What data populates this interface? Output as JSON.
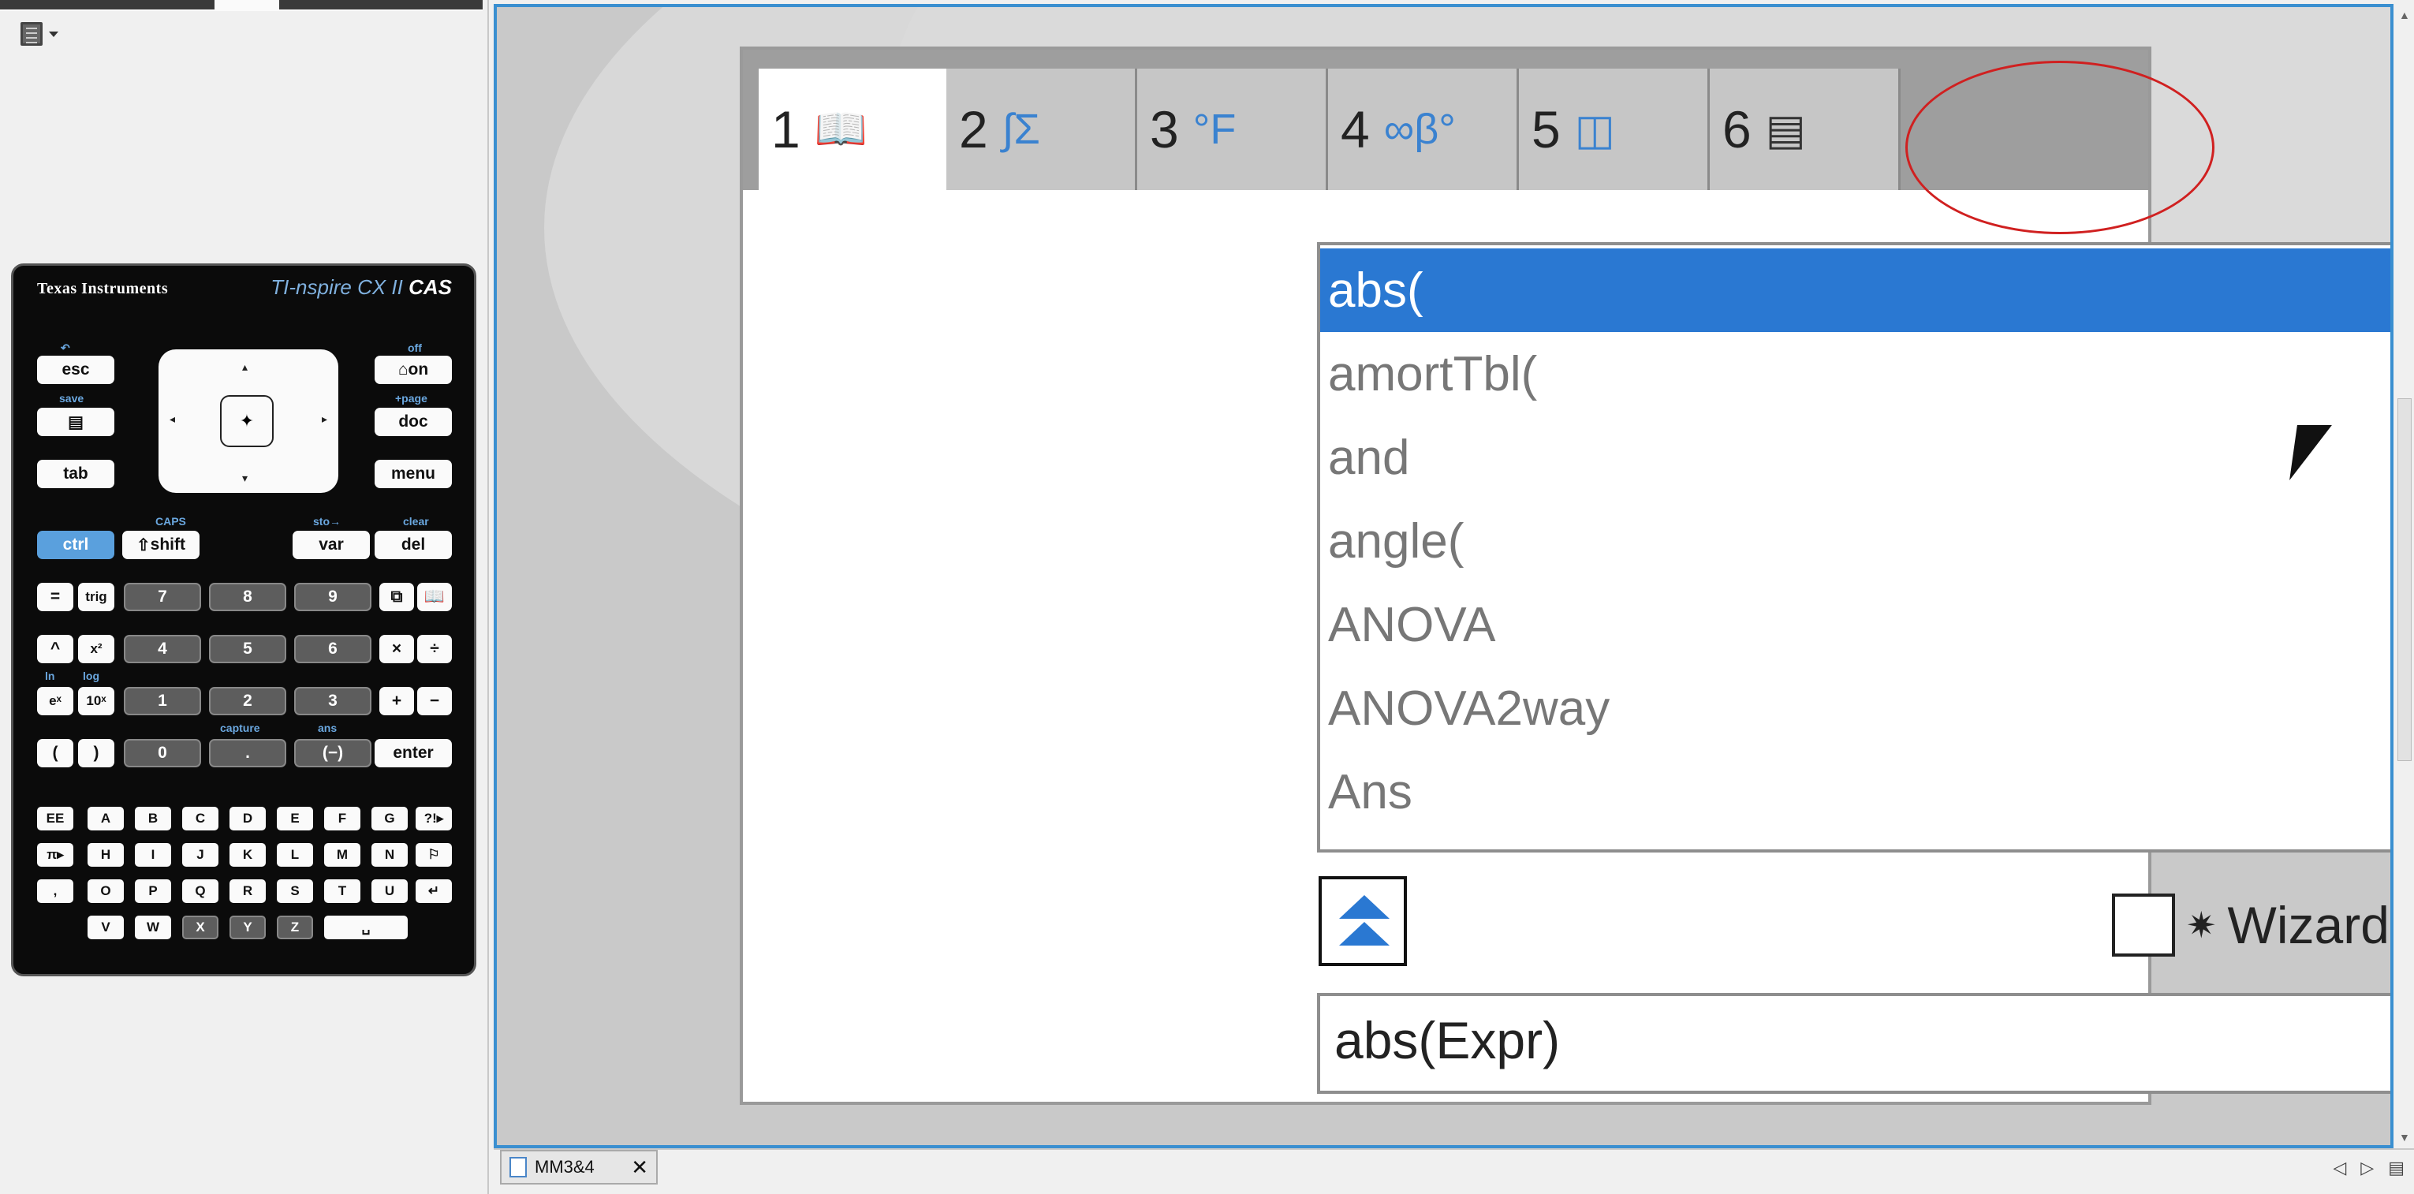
{
  "left_panel": {
    "menu_icon": "page-sorter-icon",
    "calculator": {
      "brand": "Texas Instruments",
      "model": "TI-nspire CX II",
      "model_suffix": "CAS",
      "keys_top": [
        "esc",
        "on",
        "doc",
        "tab",
        "menu"
      ],
      "labels_top": [
        "save",
        "off",
        "+page",
        "CAPS",
        "sto→",
        "clear"
      ],
      "ctrl": "ctrl",
      "shift": "shift",
      "var": "var",
      "del": "del",
      "row_keys": [
        "=",
        "trig",
        "7",
        "8",
        "9",
        "^",
        "x²",
        "4",
        "5",
        "6",
        "×",
        "÷",
        "eˣ",
        "10ˣ",
        "1",
        "2",
        "3",
        "+",
        "−",
        "(",
        ")",
        "0",
        ".",
        "(−)",
        "enter"
      ],
      "labels_mid": [
        "capture",
        "ans",
        "ln",
        "log"
      ],
      "alpha_rows": [
        [
          "EE",
          "A",
          "B",
          "C",
          "D",
          "E",
          "F",
          "G",
          "?!▸"
        ],
        [
          "π▸",
          "H",
          "I",
          "J",
          "K",
          "L",
          "M",
          "N",
          "⚐"
        ],
        [
          ",",
          "O",
          "P",
          "Q",
          "R",
          "S",
          "T",
          "U",
          "↵"
        ],
        [
          "V",
          "W",
          "X",
          "Y",
          "Z",
          "␣"
        ]
      ]
    }
  },
  "catalog": {
    "tabs": [
      {
        "num": "1",
        "icon": "catalog-book-icon",
        "glyph": "📖"
      },
      {
        "num": "2",
        "icon": "integral-sum-icon",
        "glyph": "∫Σ"
      },
      {
        "num": "3",
        "icon": "units-icon",
        "glyph": "°F"
      },
      {
        "num": "4",
        "icon": "symbols-icon",
        "glyph": "∞β°"
      },
      {
        "num": "5",
        "icon": "templates-icon",
        "glyph": "◫"
      },
      {
        "num": "6",
        "icon": "library-icon",
        "glyph": "▤"
      }
    ],
    "items": [
      {
        "label": "abs(",
        "wizard": false
      },
      {
        "label": "amortTbl(",
        "wizard": false
      },
      {
        "label": "and",
        "wizard": false
      },
      {
        "label": "angle(",
        "wizard": false
      },
      {
        "label": "ANOVA",
        "wizard": true
      },
      {
        "label": "ANOVA2way",
        "wizard": true
      },
      {
        "label": "Ans",
        "wizard": false
      }
    ],
    "selected_index": 0,
    "wizard_glyph": "✷",
    "wizards_label": "Wizards On",
    "wizards_checked": false,
    "syntax": "abs(Expr)"
  },
  "bottom": {
    "doc_tab": "MM3&4",
    "close": "✕",
    "nav": [
      "◁",
      "▷",
      "▤"
    ]
  },
  "colors": {
    "accent": "#2a78d2",
    "frame": "#3a8fd0",
    "annotation": "#d02020"
  }
}
